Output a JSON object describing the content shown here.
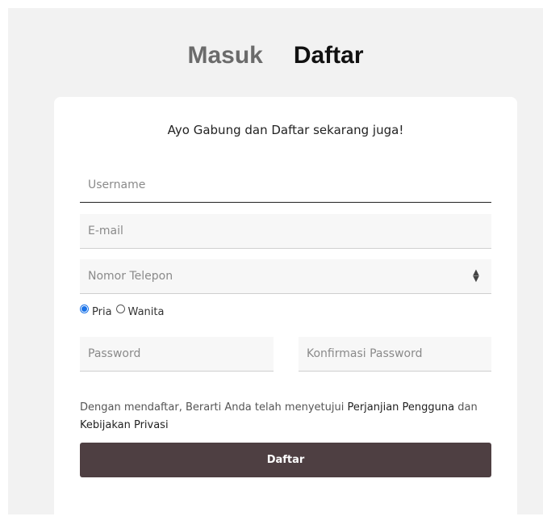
{
  "tabs": {
    "login": "Masuk",
    "register": "Daftar"
  },
  "form": {
    "heading": "Ayo Gabung dan Daftar sekarang juga!",
    "username_placeholder": "Username",
    "email_placeholder": "E-mail",
    "phone_placeholder": "Nomor Telepon",
    "gender": {
      "selected": "Pria",
      "options": [
        "Pria",
        "Wanita"
      ]
    },
    "password_placeholder": "Password",
    "confirm_password_placeholder": "Konfirmasi Password",
    "terms": {
      "prefix": "Dengan mendaftar, Berarti Anda telah menyetujui ",
      "agreement_link": "Perjanjian Pengguna",
      "connector": " dan ",
      "privacy_link": "Kebijakan Privasi"
    },
    "submit_label": "Daftar"
  },
  "colors": {
    "accent_radio": "#1a73e8",
    "submit_bg": "#4e3f42",
    "panel_bg": "#f2f2f2"
  }
}
